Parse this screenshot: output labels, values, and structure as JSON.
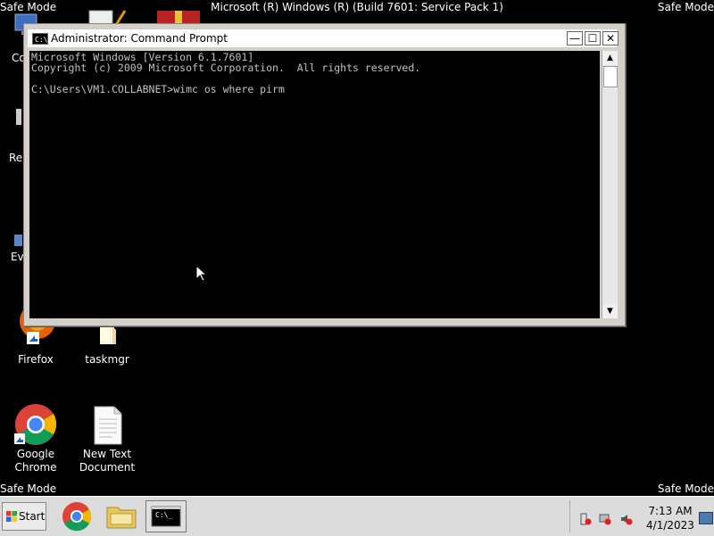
{
  "desktop": {
    "safe_mode_label": "Safe Mode",
    "top_banner": "Microsoft (R) Windows (R) (Build 7601: Service Pack 1)",
    "partial_labels": [
      "Co",
      "Re",
      "Ev"
    ],
    "icons": [
      {
        "label": "Firefox"
      },
      {
        "label": "taskmgr"
      },
      {
        "label": "Google Chrome"
      },
      {
        "label": "New Text Document"
      }
    ]
  },
  "cmd_window": {
    "title": "Administrator: Command Prompt",
    "icon_text": "C:\\",
    "buttons": {
      "minimize": "—",
      "maximize": "☐",
      "close": "✕"
    },
    "console_lines": [
      "Microsoft Windows [Version 6.1.7601]",
      "Copyright (c) 2009 Microsoft Corporation.  All rights reserved.",
      "",
      "C:\\Users\\VM1.COLLABNET>wimc os where pirm"
    ],
    "scroll_up": "▲",
    "scroll_down": "▼"
  },
  "taskbar": {
    "start_label": "Start",
    "clock_time": "7:13 AM",
    "clock_date": "4/1/2023",
    "cmd_icon_text": "C:\\_"
  },
  "colors": {
    "desktop_bg": "#000000",
    "console_text": "#c0c0c0",
    "taskbar_bg": "#dcdcdc"
  }
}
